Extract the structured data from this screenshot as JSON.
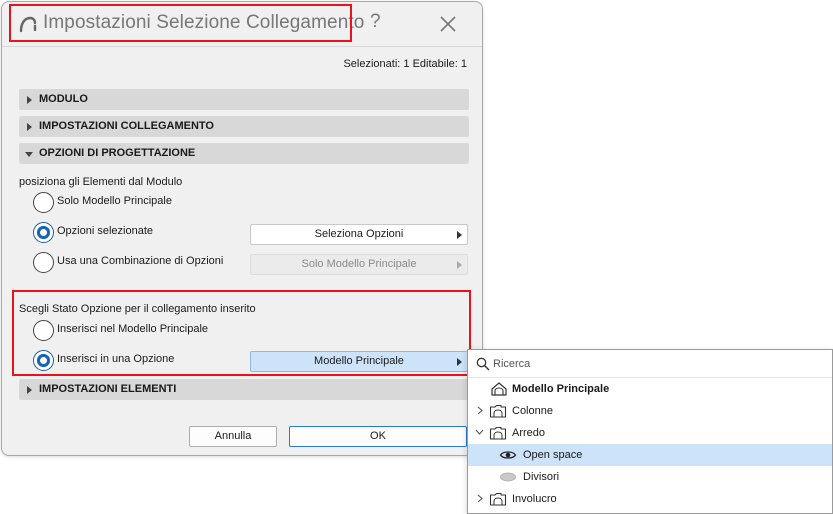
{
  "dialog": {
    "title": "Impostazioni Selezione Collegamento",
    "help_label": "?",
    "selection_info": "Selezionati: 1 Editabile: 1"
  },
  "sections": {
    "modulo": "MODULO",
    "impostazioni_collegamento": "IMPOSTAZIONI COLLEGAMENTO",
    "opzioni_progettazione": "OPZIONI DI PROGETTAZIONE",
    "impostazioni_elementi": "IMPOSTAZIONI ELEMENTI"
  },
  "position_group": {
    "label": "posiziona gli Elementi dal Modulo",
    "options": [
      {
        "label": "Solo Modello Principale",
        "checked": false
      },
      {
        "label": "Opzioni selezionate",
        "checked": true
      },
      {
        "label": "Usa una Combinazione di Opzioni",
        "checked": false
      }
    ],
    "select_options_button": "Seleziona Opzioni",
    "combination_button": "Solo Modello Principale"
  },
  "state_group": {
    "label": "Scegli Stato Opzione per il collegamento inserito",
    "options": [
      {
        "label": "Inserisci nel Modello Principale",
        "checked": false
      },
      {
        "label": "Inserisci in una Opzione",
        "checked": true
      }
    ],
    "option_button": "Modello Principale"
  },
  "footer": {
    "cancel_label": "Annulla",
    "ok_label": "OK"
  },
  "dropdown": {
    "search_placeholder": "Ricerca",
    "items": [
      {
        "label": "Modello Principale",
        "icon": "house-icon",
        "bold": true
      },
      {
        "label": "Colonne",
        "icon": "folder-icon",
        "expandable": "collapsed"
      },
      {
        "label": "Arredo",
        "icon": "folder-icon",
        "expandable": "expanded"
      },
      {
        "label": "Open space",
        "icon": "eye-icon",
        "selected": true
      },
      {
        "label": "Divisori",
        "icon": "hidden-option-icon"
      },
      {
        "label": "Involucro",
        "icon": "folder-icon",
        "expandable": "collapsed"
      }
    ]
  },
  "colors": {
    "accent": "#1565c0",
    "highlight_outline": "#e8141b",
    "selected_row": "#cde3fa"
  }
}
